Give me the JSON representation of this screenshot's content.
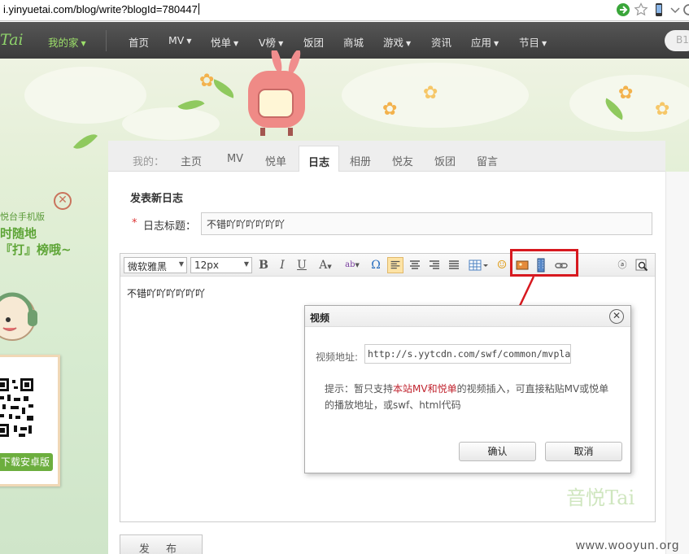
{
  "browser": {
    "url": "i.yinyuetai.com/blog/write?blogId=780447"
  },
  "topnav": {
    "logo": "Tai",
    "items": [
      {
        "label": "我的家",
        "dropdown": true
      },
      {
        "label": "首页",
        "dropdown": false
      },
      {
        "label": "MV",
        "dropdown": true
      },
      {
        "label": "悦单",
        "dropdown": true
      },
      {
        "label": "V榜",
        "dropdown": true
      },
      {
        "label": "饭团",
        "dropdown": false
      },
      {
        "label": "商城",
        "dropdown": false
      },
      {
        "label": "游戏",
        "dropdown": true
      },
      {
        "label": "资讯",
        "dropdown": false
      },
      {
        "label": "应用",
        "dropdown": true
      },
      {
        "label": "节目",
        "dropdown": true
      }
    ],
    "search_placeholder": "B1"
  },
  "promo": {
    "line1": "悦台手机版",
    "line2": "时随地",
    "line3": "『打』榜哦~",
    "download_label": "下载安卓版"
  },
  "tabs": {
    "prefix": "我的：",
    "items": [
      "主页",
      "MV",
      "悦单",
      "日志",
      "相册",
      "悦友",
      "饭团",
      "留言"
    ],
    "active": "日志"
  },
  "form": {
    "heading": "发表新日志",
    "required_mark": "*",
    "title_label": "日志标题：",
    "title_value": "不错吖吖吖吖吖吖"
  },
  "editor": {
    "font_family": "微软雅黑",
    "font_size": "12px",
    "body_text": "不错吖吖吖吖吖吖",
    "watermark": "音悦Tai"
  },
  "dialog": {
    "title": "视频",
    "url_label": "视频地址:",
    "url_value": "http://s.yytcdn.com/swf/common/mvplayer.swf",
    "tip_prefix": "提示：暂只支持",
    "tip_highlight": "本站MV和悦单",
    "tip_suffix": "的视频插入，可直接粘贴MV或悦单的播放地址，或swf、html代码",
    "confirm_label": "确认",
    "cancel_label": "取消"
  },
  "publish_label": "发 布",
  "page_watermark": "www.wooyun.org",
  "colors": {
    "nav_bg": "#454545",
    "nav_active": "#9de06a",
    "brand_green": "#6cae3e",
    "highlight_red": "#d7191f",
    "tip_red": "#c0232e"
  }
}
